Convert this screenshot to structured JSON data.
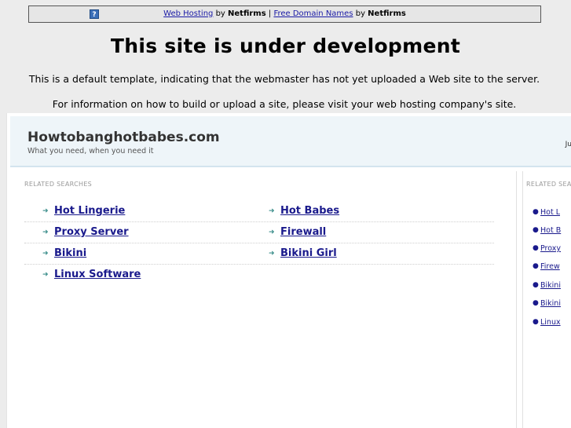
{
  "banner": {
    "link1": "Web Hosting",
    "by1": "by",
    "brand1": "Netfirms",
    "sep": "|",
    "link2": "Free Domain Names",
    "by2": "by",
    "brand2": "Netfirms"
  },
  "headline": "This site is under development",
  "line1": "This is a default template, indicating that the webmaster has not yet uploaded a Web site to the server.",
  "line2": "For information on how to build or upload a site, please visit your web hosting company's site.",
  "parked": {
    "site_title": "Howtobanghotbabes.com",
    "tagline": "What you need, when you need it",
    "header_right": "Ju",
    "related_title": "RELATED SEARCHES",
    "rows": [
      [
        "Hot Lingerie",
        "Hot Babes"
      ],
      [
        "Proxy Server",
        "Firewall"
      ],
      [
        "Bikini",
        "Bikini Girl"
      ],
      [
        "Linux Software",
        ""
      ]
    ],
    "side_title": "RELATED SEA",
    "side_items": [
      "Hot L",
      "Hot B",
      "Proxy",
      "Firew",
      "Bikini",
      "Bikini",
      "Linux"
    ]
  },
  "colors": {
    "link": "#1a1a8c",
    "arrow": "#3a8d8a",
    "header_bg": "#eef5f9"
  }
}
